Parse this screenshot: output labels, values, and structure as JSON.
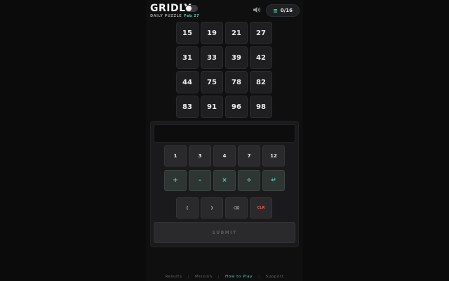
{
  "header": {
    "title": "GRIDLY",
    "subtitle": "DAILY PUZZLE",
    "date": "Feb 27",
    "score": "0/16"
  },
  "grid": {
    "numbers": [
      "15",
      "19",
      "21",
      "27",
      "31",
      "33",
      "39",
      "42",
      "44",
      "75",
      "78",
      "82",
      "83",
      "91",
      "96",
      "98"
    ]
  },
  "keypad": {
    "numbers": [
      "1",
      "3",
      "4",
      "7",
      "12"
    ],
    "operators": [
      "+",
      "-",
      "×",
      "÷",
      "↵"
    ],
    "paren_open": "(",
    "paren_close": ")",
    "backspace": "⌫",
    "clear": "CLR",
    "submit": "SUBMIT"
  },
  "footer": {
    "links": [
      "Results",
      "Mission",
      "How to Play",
      "Support"
    ],
    "active": "How to Play"
  },
  "colors": {
    "accent": "#4fd1b5",
    "clear": "#e0605f",
    "background": "#0b0b0b"
  }
}
